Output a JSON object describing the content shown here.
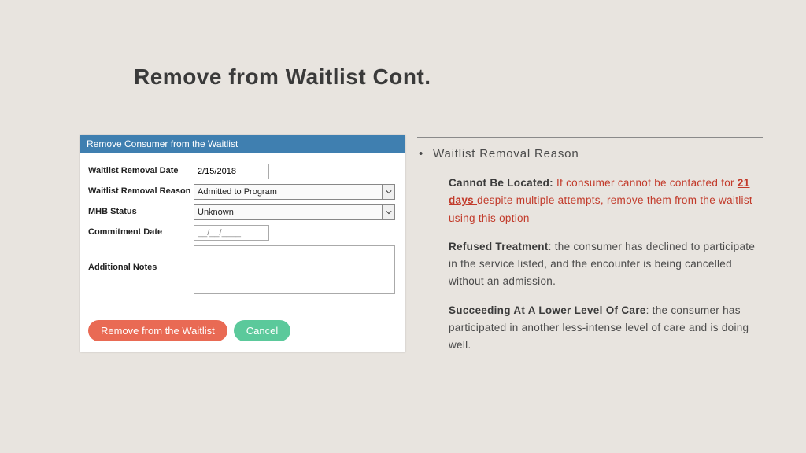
{
  "title": "Remove from Waitlist Cont.",
  "form": {
    "header": "Remove Consumer from the Waitlist",
    "rows": {
      "removal_date_label": "Waitlist Removal Date",
      "removal_date_value": "2/15/2018",
      "reason_label": "Waitlist Removal Reason",
      "reason_value": "Admitted to Program",
      "mhb_label": "MHB Status",
      "mhb_value": "Unknown",
      "commitment_label": "Commitment Date",
      "commitment_value": "__/__/____",
      "notes_label": "Additional Notes"
    },
    "buttons": {
      "remove": "Remove from the Waitlist",
      "cancel": "Cancel"
    }
  },
  "right": {
    "bullet": "Waitlist Removal Reason",
    "r1_label": "Cannot Be Located:",
    "r1_pre": " If consumer cannot be contacted for ",
    "r1_days": "21 days ",
    "r1_post": "despite multiple attempts, remove them from the waitlist using this option",
    "r2_label": "Refused Treatment",
    "r2_text": ": the consumer has declined to participate in the service listed, and the encounter is being cancelled without an admission.",
    "r3_label": "Succeeding At A Lower Level Of Care",
    "r3_text": ": the consumer has participated in another less-intense level of care and is doing well."
  }
}
